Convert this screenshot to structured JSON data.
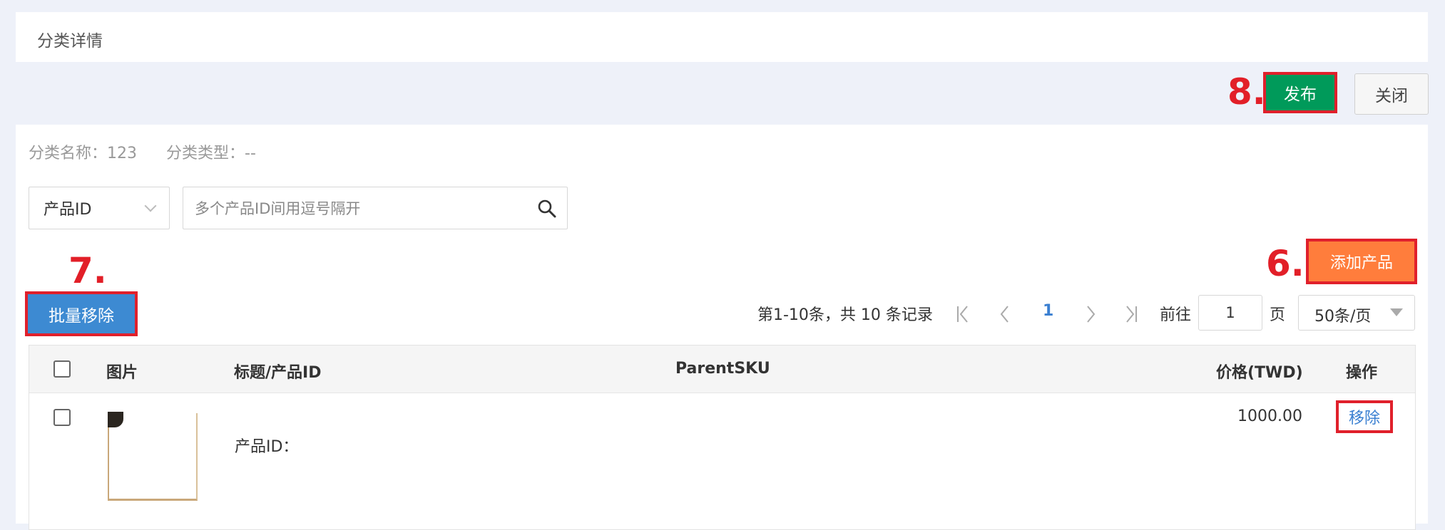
{
  "header": {
    "title": "分类详情"
  },
  "actions": {
    "publish_label": "发布",
    "close_label": "关闭"
  },
  "annotations": {
    "step6": "6.",
    "step7": "7.",
    "step8": "8.",
    "color": "#e21f28"
  },
  "category": {
    "name_text": "分类名称：123",
    "type_text": "分类类型：--"
  },
  "search": {
    "select_value": "产品ID",
    "placeholder": "多个产品ID间用逗号隔开"
  },
  "toolbar": {
    "add_product_label": "添加产品",
    "batch_remove_label": "批量移除"
  },
  "pagination": {
    "summary": "第1-10条，共 10 条记录",
    "current_page": "1",
    "goto_label": "前往",
    "page_input_value": "1",
    "page_unit": "页",
    "page_size": "50条/页"
  },
  "table": {
    "columns": {
      "image": "图片",
      "title": "标题/产品ID",
      "parent_sku": "ParentSKU",
      "price": "价格(TWD)",
      "action": "操作"
    },
    "rows": [
      {
        "product_id_label": "产品ID：",
        "price": "1000.00",
        "action_label": "移除"
      }
    ]
  },
  "colors": {
    "publish": "#009a5a",
    "add_product": "#ff7d3c",
    "batch_remove": "#3d8ad2",
    "link": "#3a7fd1"
  }
}
